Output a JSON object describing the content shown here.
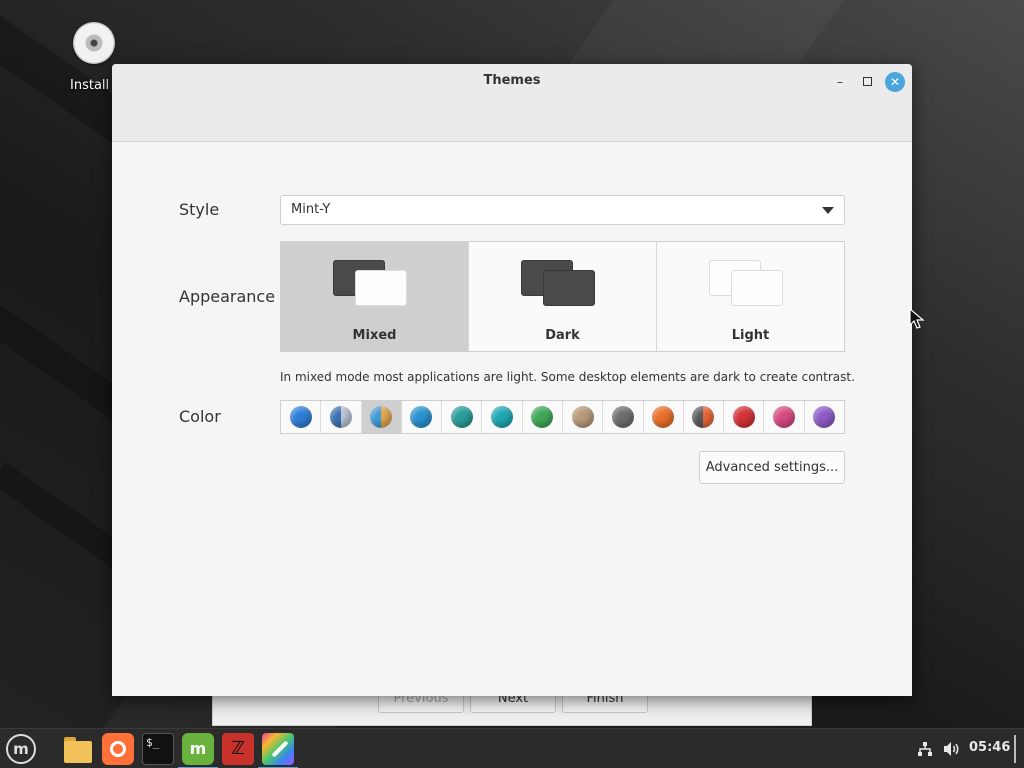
{
  "desktop": {
    "icon_label": "Install"
  },
  "installer": {
    "previous_label": "Previous",
    "next_label": "Next",
    "finish_label": "Finish"
  },
  "window": {
    "title": "Themes",
    "minimize_glyph": "–",
    "close_glyph": "✕"
  },
  "style": {
    "label": "Style",
    "value": "Mint-Y"
  },
  "appearance": {
    "label": "Appearance",
    "options": [
      {
        "label": "Mixed",
        "selected": true
      },
      {
        "label": "Dark",
        "selected": false
      },
      {
        "label": "Light",
        "selected": false
      }
    ],
    "hint": "In mixed mode most applications are light. Some desktop elements are dark to create contrast."
  },
  "color": {
    "label": "Color",
    "swatches": [
      {
        "name": "blue",
        "color": "#2f7fd8",
        "selected": false
      },
      {
        "name": "blue-mixed",
        "color": "#3a6fb0",
        "color2": "#b9c4d4",
        "selected": false
      },
      {
        "name": "aqua-mixed",
        "color": "#3d9ad6",
        "color2": "#e2a64e",
        "selected": true
      },
      {
        "name": "aqua",
        "color": "#2a92d0",
        "selected": false
      },
      {
        "name": "teal",
        "color": "#2a9d9a",
        "selected": false
      },
      {
        "name": "cyan",
        "color": "#1fa8b3",
        "selected": false
      },
      {
        "name": "green",
        "color": "#3fa857",
        "selected": false
      },
      {
        "name": "sand",
        "color": "#b89a7a",
        "selected": false
      },
      {
        "name": "grey",
        "color": "#6e6e6e",
        "selected": false
      },
      {
        "name": "orange",
        "color": "#ea6f2c",
        "selected": false
      },
      {
        "name": "orange-mixed",
        "color": "#5a5a5a",
        "color2": "#e8683a",
        "selected": false
      },
      {
        "name": "red",
        "color": "#d23238",
        "selected": false
      },
      {
        "name": "pink",
        "color": "#d64b82",
        "selected": false
      },
      {
        "name": "purple",
        "color": "#8e5cc8",
        "selected": false
      }
    ]
  },
  "advanced_label": "Advanced settings...",
  "taskbar": {
    "clock": "05:46",
    "mint_glyph": "m",
    "terminal_glyph": "$_",
    "red_app_glyph": "ℤ"
  }
}
